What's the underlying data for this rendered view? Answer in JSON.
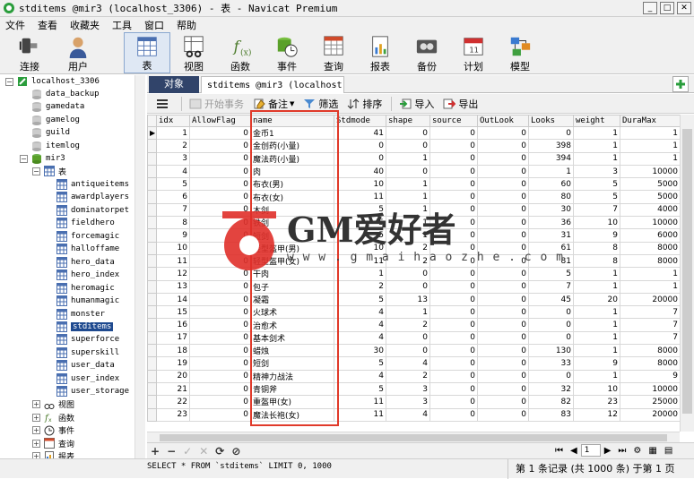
{
  "window": {
    "title": "stditems @mir3 (localhost_3306) - 表 - Navicat Premium"
  },
  "menu": [
    "文件",
    "查看",
    "收藏夹",
    "工具",
    "窗口",
    "帮助"
  ],
  "toolbar": [
    "连接",
    "用户",
    "表",
    "视图",
    "函数",
    "事件",
    "查询",
    "报表",
    "备份",
    "计划",
    "模型"
  ],
  "tree": {
    "connection": "localhost_3306",
    "databases": [
      "data_backup",
      "gamedata",
      "gamelog",
      "guild",
      "itemlog",
      "mir3"
    ],
    "tables_group": "表",
    "tables": [
      "antiqueitems",
      "awardplayers",
      "dominatorpet",
      "fieldhero",
      "forcemagic",
      "halloffame",
      "hero_data",
      "hero_index",
      "heromagic",
      "humanmagic",
      "monster",
      "stditems",
      "superforce",
      "superskill",
      "user_data",
      "user_index",
      "user_storage"
    ],
    "selected_table": "stditems",
    "other_groups": [
      "视图",
      "函数",
      "事件",
      "查询",
      "报表"
    ]
  },
  "tabs": {
    "objects": "对象",
    "table_tab": "stditems @mir3 (localhost..."
  },
  "subtoolbar": {
    "begin_tx": "开始事务",
    "notes": "备注",
    "filter": "筛选",
    "sort": "排序",
    "import": "导入",
    "export": "导出"
  },
  "grid": {
    "columns": [
      "idx",
      "AllowFlag",
      "name",
      "Stdmode",
      "shape",
      "source",
      "OutLook",
      "Looks",
      "weight",
      "DuraMax"
    ],
    "rows": [
      [
        "1",
        "0",
        "金币1",
        "41",
        "0",
        "0",
        "0",
        "0",
        "1",
        "1"
      ],
      [
        "2",
        "0",
        "金创药(小量)",
        "0",
        "0",
        "0",
        "0",
        "398",
        "1",
        "1"
      ],
      [
        "3",
        "0",
        "魔法药(小量)",
        "0",
        "1",
        "0",
        "0",
        "394",
        "1",
        "1"
      ],
      [
        "4",
        "0",
        "肉",
        "40",
        "0",
        "0",
        "0",
        "1",
        "3",
        "10000"
      ],
      [
        "5",
        "0",
        "布衣(男)",
        "10",
        "1",
        "0",
        "0",
        "60",
        "5",
        "5000"
      ],
      [
        "6",
        "0",
        "布衣(女)",
        "11",
        "1",
        "0",
        "0",
        "80",
        "5",
        "5000"
      ],
      [
        "7",
        "0",
        "木剑",
        "5",
        "1",
        "0",
        "0",
        "30",
        "7",
        "4000"
      ],
      [
        "8",
        "0",
        "铁剑",
        "5",
        "1",
        "0",
        "0",
        "36",
        "10",
        "10000"
      ],
      [
        "9",
        "0",
        "短剑",
        "5",
        "1",
        "0",
        "0",
        "31",
        "9",
        "6000"
      ],
      [
        "10",
        "0",
        "轻型盔甲(男)",
        "10",
        "2",
        "0",
        "0",
        "61",
        "8",
        "8000"
      ],
      [
        "11",
        "0",
        "轻型盔甲(女)",
        "11",
        "2",
        "0",
        "0",
        "81",
        "8",
        "8000"
      ],
      [
        "12",
        "0",
        "干肉",
        "1",
        "0",
        "0",
        "0",
        "5",
        "1",
        "1"
      ],
      [
        "13",
        "0",
        "包子",
        "2",
        "0",
        "0",
        "0",
        "7",
        "1",
        "1"
      ],
      [
        "14",
        "0",
        "凝霜",
        "5",
        "13",
        "0",
        "0",
        "45",
        "20",
        "20000"
      ],
      [
        "15",
        "0",
        "火球术",
        "4",
        "1",
        "0",
        "0",
        "0",
        "1",
        "7"
      ],
      [
        "16",
        "0",
        "治愈术",
        "4",
        "2",
        "0",
        "0",
        "0",
        "1",
        "7"
      ],
      [
        "17",
        "0",
        "基本剑术",
        "4",
        "0",
        "0",
        "0",
        "0",
        "1",
        "7"
      ],
      [
        "18",
        "0",
        "蜡烛",
        "30",
        "0",
        "0",
        "0",
        "130",
        "1",
        "8000"
      ],
      [
        "19",
        "0",
        "短剑",
        "5",
        "4",
        "0",
        "0",
        "33",
        "9",
        "8000"
      ],
      [
        "20",
        "0",
        "精神力战法",
        "4",
        "2",
        "0",
        "0",
        "0",
        "1",
        "9"
      ],
      [
        "21",
        "0",
        "青铜斧",
        "5",
        "3",
        "0",
        "0",
        "32",
        "10",
        "10000"
      ],
      [
        "22",
        "0",
        "重盔甲(女)",
        "11",
        "3",
        "0",
        "0",
        "82",
        "23",
        "25000"
      ],
      [
        "23",
        "0",
        "魔法长袍(女)",
        "11",
        "4",
        "0",
        "0",
        "83",
        "12",
        "20000"
      ]
    ]
  },
  "pager": {
    "page": "1"
  },
  "status": {
    "sql": "SELECT * FROM `stditems` LIMIT 0, 1000",
    "records": "第 1 条记录 (共 1000 条) 于第 1 页"
  },
  "watermark": {
    "brand": "GM爱好者",
    "url": "w w w . g m a i h a o z h e . c o m"
  },
  "colors": {
    "highlight": "#e03a2a",
    "tab_active": "#31446a",
    "selection": "#1f4a8f"
  }
}
